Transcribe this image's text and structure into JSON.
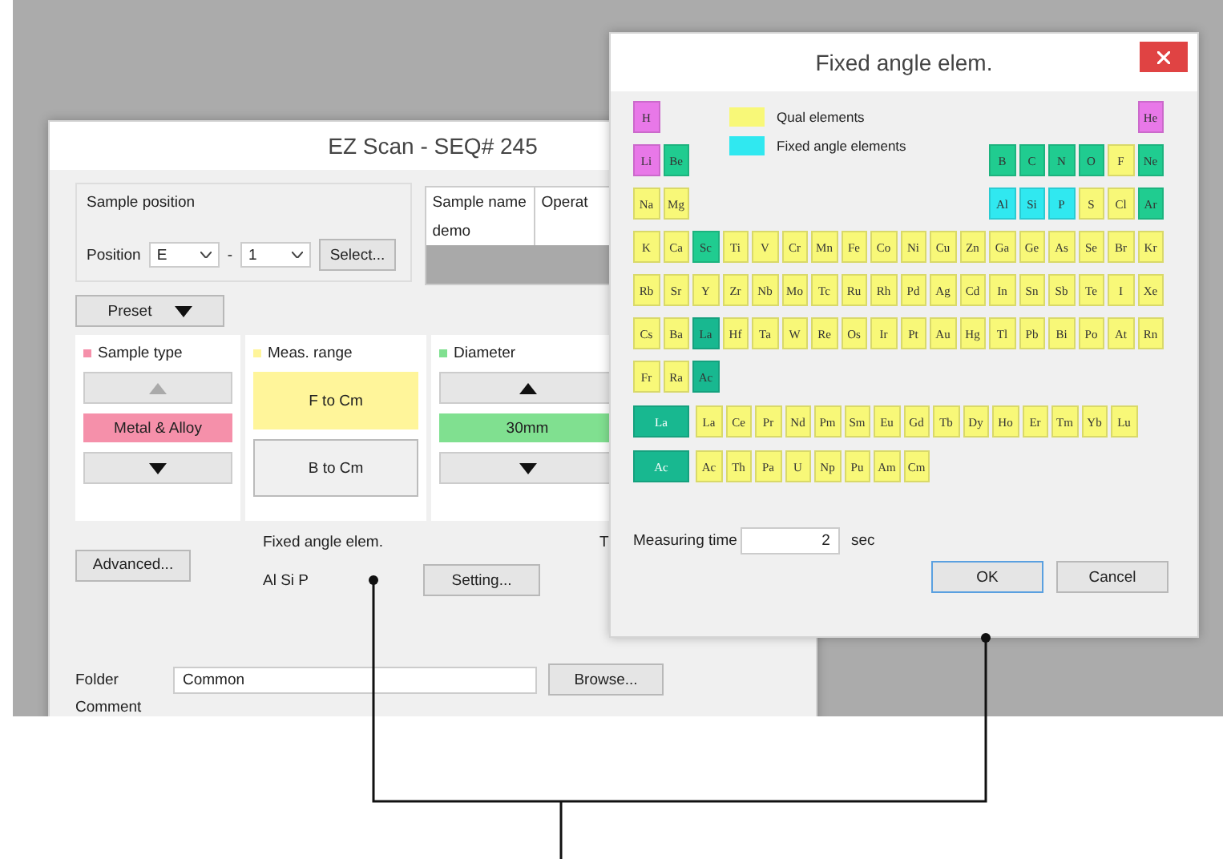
{
  "main_window": {
    "title": "EZ Scan - SEQ# 245",
    "sample_position": {
      "label": "Sample position",
      "position_label": "Position",
      "position_value": "E",
      "separator": "-",
      "slot_value": "1",
      "select_button": "Select..."
    },
    "sample_table": {
      "columns": [
        "Sample name",
        "Operat"
      ],
      "rows": [
        {
          "cells": [
            "demo"
          ]
        }
      ]
    },
    "preset_button": "Preset",
    "panels": [
      {
        "label": "Sample type",
        "color": "#f590aa",
        "kind": "stepper",
        "value": "Metal & Alloy",
        "up_disabled": true
      },
      {
        "label": "Meas. range",
        "color": "#fff59a",
        "kind": "choice",
        "options": [
          {
            "label": "F to Cm",
            "selected": true
          },
          {
            "label": "B to Cm",
            "selected": false
          }
        ]
      },
      {
        "label": "Diameter",
        "color": "#80e090",
        "kind": "stepper",
        "value": "30mm",
        "up_disabled": false
      }
    ],
    "advanced_button": "Advanced...",
    "fixed_angle": {
      "label": "Fixed angle elem.",
      "value": "Al Si P",
      "setting_button": "Setting..."
    },
    "cut_text": "T",
    "folder": {
      "label": "Folder",
      "value": "Common",
      "browse_button": "Browse..."
    },
    "comment_label": "Comment"
  },
  "dialog": {
    "title": "Fixed angle elem.",
    "legend": [
      {
        "label": "Qual elements",
        "color": "#f8f878"
      },
      {
        "label": "Fixed angle elements",
        "color": "#30e8f0"
      }
    ],
    "table": {
      "rows": [
        [
          {
            "symbol": "H",
            "color": "#e878e8"
          },
          null,
          null,
          null,
          null,
          null,
          null,
          null,
          null,
          null,
          null,
          null,
          null,
          null,
          null,
          null,
          null,
          {
            "symbol": "He",
            "color": "#e878e8"
          }
        ],
        [
          {
            "symbol": "Li",
            "color": "#e878e8"
          },
          {
            "symbol": "Be",
            "color": "#20cc90"
          },
          null,
          null,
          null,
          null,
          null,
          null,
          null,
          null,
          null,
          null,
          {
            "symbol": "B",
            "color": "#20cc90"
          },
          {
            "symbol": "C",
            "color": "#20cc90"
          },
          {
            "symbol": "N",
            "color": "#20cc90"
          },
          {
            "symbol": "O",
            "color": "#20cc90"
          },
          {
            "symbol": "F",
            "color": "#f8f878"
          },
          {
            "symbol": "Ne",
            "color": "#20cc90"
          }
        ],
        [
          {
            "symbol": "Na",
            "color": "#f8f878"
          },
          {
            "symbol": "Mg",
            "color": "#f8f878"
          },
          null,
          null,
          null,
          null,
          null,
          null,
          null,
          null,
          null,
          null,
          {
            "symbol": "Al",
            "color": "#30e8f0"
          },
          {
            "symbol": "Si",
            "color": "#30e8f0"
          },
          {
            "symbol": "P",
            "color": "#30e8f0"
          },
          {
            "symbol": "S",
            "color": "#f8f878"
          },
          {
            "symbol": "Cl",
            "color": "#f8f878"
          },
          {
            "symbol": "Ar",
            "color": "#20cc90"
          }
        ],
        [
          {
            "symbol": "K",
            "color": "#f8f878"
          },
          {
            "symbol": "Ca",
            "color": "#f8f878"
          },
          {
            "symbol": "Sc",
            "color": "#20cc90"
          },
          {
            "symbol": "Ti",
            "color": "#f8f878"
          },
          {
            "symbol": "V",
            "color": "#f8f878"
          },
          {
            "symbol": "Cr",
            "color": "#f8f878"
          },
          {
            "symbol": "Mn",
            "color": "#f8f878"
          },
          {
            "symbol": "Fe",
            "color": "#f8f878"
          },
          {
            "symbol": "Co",
            "color": "#f8f878"
          },
          {
            "symbol": "Ni",
            "color": "#f8f878"
          },
          {
            "symbol": "Cu",
            "color": "#f8f878"
          },
          {
            "symbol": "Zn",
            "color": "#f8f878"
          },
          {
            "symbol": "Ga",
            "color": "#f8f878"
          },
          {
            "symbol": "Ge",
            "color": "#f8f878"
          },
          {
            "symbol": "As",
            "color": "#f8f878"
          },
          {
            "symbol": "Se",
            "color": "#f8f878"
          },
          {
            "symbol": "Br",
            "color": "#f8f878"
          },
          {
            "symbol": "Kr",
            "color": "#f8f878"
          }
        ],
        [
          {
            "symbol": "Rb",
            "color": "#f8f878"
          },
          {
            "symbol": "Sr",
            "color": "#f8f878"
          },
          {
            "symbol": "Y",
            "color": "#f8f878"
          },
          {
            "symbol": "Zr",
            "color": "#f8f878"
          },
          {
            "symbol": "Nb",
            "color": "#f8f878"
          },
          {
            "symbol": "Mo",
            "color": "#f8f878"
          },
          {
            "symbol": "Tc",
            "color": "#f8f878"
          },
          {
            "symbol": "Ru",
            "color": "#f8f878"
          },
          {
            "symbol": "Rh",
            "color": "#f8f878"
          },
          {
            "symbol": "Pd",
            "color": "#f8f878"
          },
          {
            "symbol": "Ag",
            "color": "#f8f878"
          },
          {
            "symbol": "Cd",
            "color": "#f8f878"
          },
          {
            "symbol": "In",
            "color": "#f8f878"
          },
          {
            "symbol": "Sn",
            "color": "#f8f878"
          },
          {
            "symbol": "Sb",
            "color": "#f8f878"
          },
          {
            "symbol": "Te",
            "color": "#f8f878"
          },
          {
            "symbol": "I",
            "color": "#f8f878"
          },
          {
            "symbol": "Xe",
            "color": "#f8f878"
          }
        ],
        [
          {
            "symbol": "Cs",
            "color": "#f8f878"
          },
          {
            "symbol": "Ba",
            "color": "#f8f878"
          },
          {
            "symbol": "La",
            "color": "#18b890"
          },
          {
            "symbol": "Hf",
            "color": "#f8f878"
          },
          {
            "symbol": "Ta",
            "color": "#f8f878"
          },
          {
            "symbol": "W",
            "color": "#f8f878"
          },
          {
            "symbol": "Re",
            "color": "#f8f878"
          },
          {
            "symbol": "Os",
            "color": "#f8f878"
          },
          {
            "symbol": "Ir",
            "color": "#f8f878"
          },
          {
            "symbol": "Pt",
            "color": "#f8f878"
          },
          {
            "symbol": "Au",
            "color": "#f8f878"
          },
          {
            "symbol": "Hg",
            "color": "#f8f878"
          },
          {
            "symbol": "Tl",
            "color": "#f8f878"
          },
          {
            "symbol": "Pb",
            "color": "#f8f878"
          },
          {
            "symbol": "Bi",
            "color": "#f8f878"
          },
          {
            "symbol": "Po",
            "color": "#f8f878"
          },
          {
            "symbol": "At",
            "color": "#f8f878"
          },
          {
            "symbol": "Rn",
            "color": "#f8f878"
          }
        ],
        [
          {
            "symbol": "Fr",
            "color": "#f8f878"
          },
          {
            "symbol": "Ra",
            "color": "#f8f878"
          },
          {
            "symbol": "Ac",
            "color": "#18b890"
          }
        ]
      ],
      "series": [
        {
          "lead": {
            "symbol": "La",
            "color": "#18b890"
          },
          "cells": [
            {
              "symbol": "La",
              "color": "#f8f878"
            },
            {
              "symbol": "Ce",
              "color": "#f8f878"
            },
            {
              "symbol": "Pr",
              "color": "#f8f878"
            },
            {
              "symbol": "Nd",
              "color": "#f8f878"
            },
            {
              "symbol": "Pm",
              "color": "#f8f878"
            },
            {
              "symbol": "Sm",
              "color": "#f8f878"
            },
            {
              "symbol": "Eu",
              "color": "#f8f878"
            },
            {
              "symbol": "Gd",
              "color": "#f8f878"
            },
            {
              "symbol": "Tb",
              "color": "#f8f878"
            },
            {
              "symbol": "Dy",
              "color": "#f8f878"
            },
            {
              "symbol": "Ho",
              "color": "#f8f878"
            },
            {
              "symbol": "Er",
              "color": "#f8f878"
            },
            {
              "symbol": "Tm",
              "color": "#f8f878"
            },
            {
              "symbol": "Yb",
              "color": "#f8f878"
            },
            {
              "symbol": "Lu",
              "color": "#f8f878"
            }
          ]
        },
        {
          "lead": {
            "symbol": "Ac",
            "color": "#18b890"
          },
          "cells": [
            {
              "symbol": "Ac",
              "color": "#f8f878"
            },
            {
              "symbol": "Th",
              "color": "#f8f878"
            },
            {
              "symbol": "Pa",
              "color": "#f8f878"
            },
            {
              "symbol": "U",
              "color": "#f8f878"
            },
            {
              "symbol": "Np",
              "color": "#f8f878"
            },
            {
              "symbol": "Pu",
              "color": "#f8f878"
            },
            {
              "symbol": "Am",
              "color": "#f8f878"
            },
            {
              "symbol": "Cm",
              "color": "#f8f878"
            }
          ]
        }
      ]
    },
    "measuring_time": {
      "label": "Measuring time",
      "value": "2",
      "unit": "sec"
    },
    "buttons": [
      {
        "label": "OK",
        "default": true
      },
      {
        "label": "Cancel",
        "default": false
      }
    ]
  }
}
